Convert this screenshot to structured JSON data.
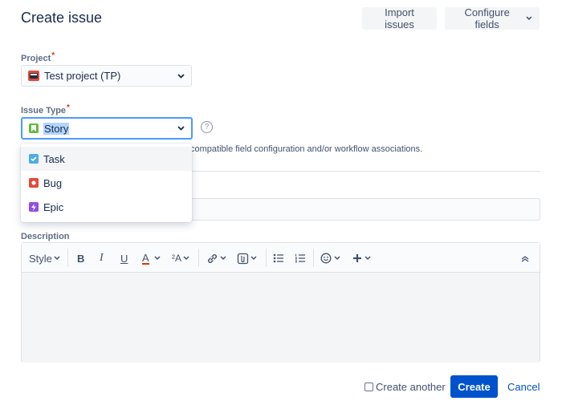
{
  "dialog": {
    "title": "Create issue",
    "import_label": "Import issues",
    "configure_label": "Configure fields"
  },
  "project": {
    "label": "Project",
    "required_mark": "*",
    "value": "Test project (TP)"
  },
  "issue_type": {
    "label": "Issue Type",
    "required_mark": "*",
    "value": "Story",
    "help_glyph": "?",
    "info_text": "compatible field configuration and/or workflow associations.",
    "options": [
      {
        "label": "Task",
        "icon": "task-icon",
        "color": "#4bade8"
      },
      {
        "label": "Bug",
        "icon": "bug-icon",
        "color": "#e5493a"
      },
      {
        "label": "Epic",
        "icon": "epic-icon",
        "color": "#904ee2"
      }
    ]
  },
  "description": {
    "label": "Description",
    "toolbar": {
      "style_label": "Style",
      "bold": "B",
      "italic": "I",
      "underline": "U",
      "text_color": "A",
      "more_formatting": "²A"
    }
  },
  "footer": {
    "create_another_label": "Create another",
    "create_label": "Create",
    "cancel_label": "Cancel"
  },
  "colors": {
    "primary": "#0052cc",
    "focus_border": "#4c9aff",
    "story_icon": "#63ba3c",
    "required": "#de350b"
  }
}
